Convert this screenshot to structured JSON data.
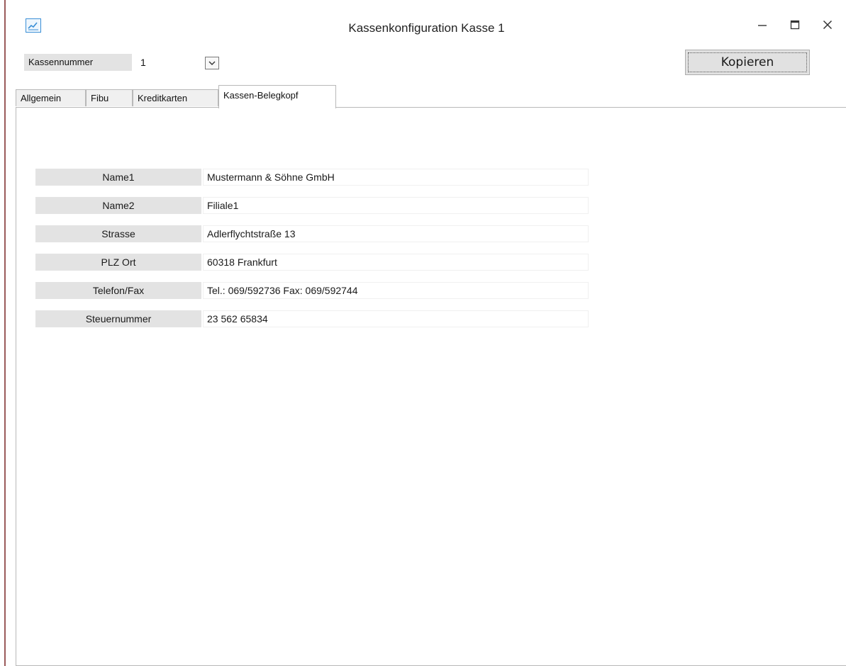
{
  "window": {
    "title": "Kassenkonfiguration Kasse 1",
    "icon": "chart-window-icon",
    "controls": [
      "minimize-icon",
      "maximize-icon",
      "close-icon"
    ]
  },
  "header": {
    "kassennummer_label": "Kassennummer",
    "kassennummer_value": "1",
    "copy_button": "Kopieren"
  },
  "tabs": [
    {
      "label": "Allgemein",
      "active": false
    },
    {
      "label": "Fibu",
      "active": false
    },
    {
      "label": "Kreditkarten",
      "active": false
    },
    {
      "label": "Kassen-Belegkopf",
      "active": true
    }
  ],
  "form": {
    "rows": [
      {
        "label": "Name1",
        "value": "Mustermann & Söhne GmbH"
      },
      {
        "label": "Name2",
        "value": "Filiale1"
      },
      {
        "label": "Strasse",
        "value": "Adlerflychtstraße 13"
      },
      {
        "label": "PLZ Ort",
        "value": "60318 Frankfurt"
      },
      {
        "label": "Telefon/Fax",
        "value": "Tel.: 069/592736 Fax: 069/592744"
      },
      {
        "label": "Steuernummer",
        "value": "23 562 65834"
      }
    ]
  },
  "colors": {
    "label_bg": "#e3e3e3",
    "icon_accent": "#3a8fd6",
    "border": "#b8b8b8"
  }
}
